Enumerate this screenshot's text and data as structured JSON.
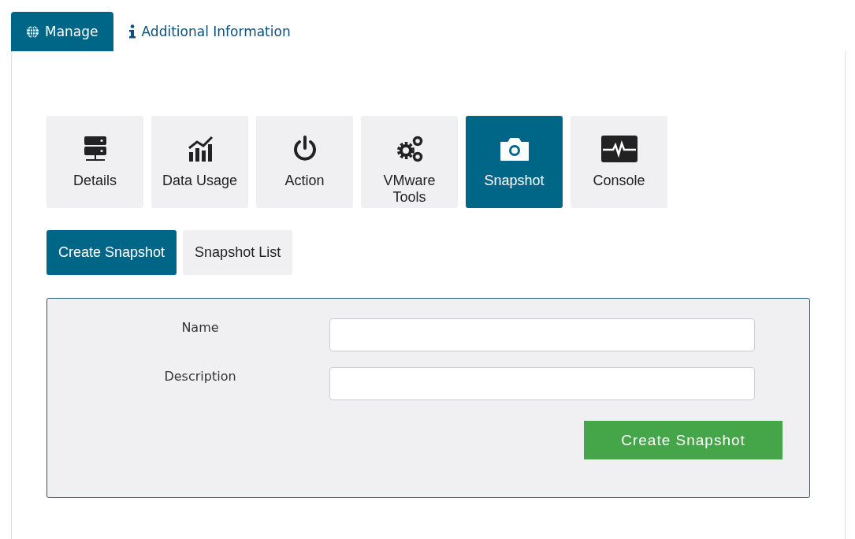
{
  "tabs": [
    {
      "label": "Manage",
      "selected": true
    },
    {
      "label": "Additional Information",
      "selected": false
    }
  ],
  "tools": [
    {
      "label": "Details",
      "selected": false
    },
    {
      "label": "Data Usage",
      "selected": false
    },
    {
      "label": "Action",
      "selected": false
    },
    {
      "label": "VMware Tools",
      "selected": false
    },
    {
      "label": "Snapshot",
      "selected": true
    },
    {
      "label": "Console",
      "selected": false
    }
  ],
  "subtabs": [
    {
      "label": "Create Snapshot",
      "selected": true
    },
    {
      "label": "Snapshot List",
      "selected": false
    }
  ],
  "form": {
    "fields": [
      {
        "label": "Name"
      },
      {
        "label": "Description"
      }
    ],
    "submit": "Create Snapshot"
  }
}
